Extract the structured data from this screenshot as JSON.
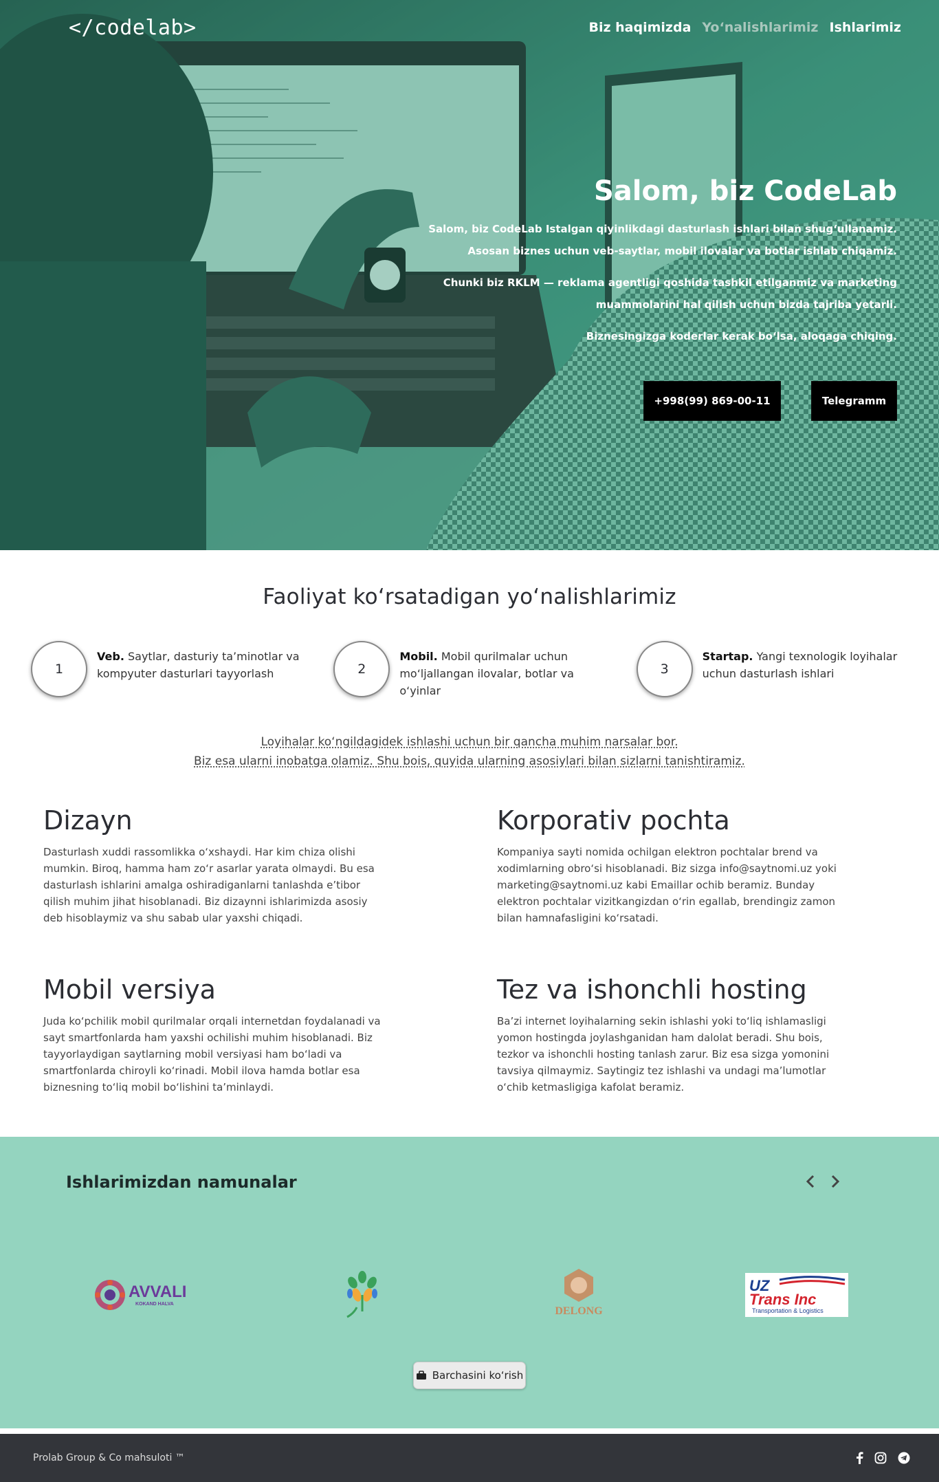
{
  "nav": {
    "logo": "</codelab>",
    "links": [
      {
        "label": "Biz haqimizda",
        "active": false
      },
      {
        "label": "Yo‘nalishlarimiz",
        "active": true
      },
      {
        "label": "Ishlarimiz",
        "active": false
      }
    ]
  },
  "hero": {
    "title": "Salom, biz CodeLab",
    "paragraphs": [
      "Salom, biz CodeLab Istalgan qiyinlikdagi dasturlash ishlari bilan shug‘ullanamiz. Asosan biznes uchun veb-saytlar, mobil ilovalar va botlar ishlab chiqamiz.",
      "Chunki biz RKLM — reklama agentligi qoshida tashkil etilganmiz va marketing muammolarini hal qilish uchun bizda tajriba yetarli.",
      "Biznesingizga koderlar kerak bo‘lsa, aloqaga chiqing."
    ],
    "phone_button": "+998(99) 869-00-11",
    "telegram_button": "Telegramm"
  },
  "services": {
    "title": "Faoliyat ko‘rsatadigan yo‘nalishlarimiz",
    "steps": [
      {
        "number": "1",
        "bold": "Veb.",
        "text": "Saytlar, dasturiy ta’minotlar va kompyuter dasturlari tayyorlash"
      },
      {
        "number": "2",
        "bold": "Mobil.",
        "text": "Mobil qurilmalar uchun mo‘ljallangan ilovalar, botlar va o‘yinlar"
      },
      {
        "number": "3",
        "bold": "Startap.",
        "text": "Yangi texnologik loyihalar uchun dasturlash ishlari"
      }
    ],
    "intro_line1": "Loyihalar ko‘ngildagidek ishlashi uchun bir qancha muhim narsalar bor.",
    "intro_line2": "Biz esa ularni inobatga olamiz. Shu bois, quyida ularning asosiylari bilan sizlarni tanishtiramiz.",
    "features": [
      {
        "title": "Dizayn",
        "text": "Dasturlash xuddi rassomlikka o‘xshaydi. Har kim chiza olishi mumkin. Biroq, hamma ham zo‘r asarlar yarata olmaydi. Bu esa dasturlash ishlarini amalga oshiradiganlarni tanlashda e’tibor qilish muhim jihat hisoblanadi. Biz dizaynni ishlarimizda asosiy deb hisoblaymiz va shu sabab ular yaxshi chiqadi."
      },
      {
        "title": "Korporativ pochta",
        "text": "Kompaniya sayti nomida ochilgan elektron pochtalar brend va xodimlarning obro‘si hisoblanadi. Biz sizga info@saytnomi.uz yoki marketing@saytnomi.uz kabi Emaillar ochib beramiz. Bunday elektron pochtalar vizitkangizdan o‘rin egallab, brendingiz zamon bilan hamnafasligini ko‘rsatadi."
      },
      {
        "title": "Mobil versiya",
        "text": "Juda ko‘pchilik mobil qurilmalar orqali internetdan foydalanadi va sayt smartfonlarda ham yaxshi ochilishi muhim hisoblanadi. Biz tayyorlaydigan saytlarning mobil versiyasi ham bo‘ladi va smartfonlarda chiroyli ko‘rinadi. Mobil ilova hamda botlar esa biznesning to‘liq mobil bo‘lishini ta’minlaydi."
      },
      {
        "title": "Tez va ishonchli hosting",
        "text": "Ba’zi internet loyihalarning sekin ishlashi yoki to‘liq ishlamasligi yomon hostingda joylashganidan ham dalolat beradi. Shu bois, tezkor va ishonchli hosting tanlash zarur. Biz esa sizga yomonini tavsiya qilmaymiz. Saytingiz tez ishlashi va undagi ma’lumotlar o‘chib ketmasligiga kafolat beramiz."
      }
    ]
  },
  "portfolio": {
    "title": "Ishlarimizdan namunalar",
    "view_all": "Barchasini ko‘rish",
    "logos": [
      {
        "name": "AVVALI",
        "sub": "KOKAND HALVA"
      },
      {
        "name": "hands-tree-logo"
      },
      {
        "name": "DELONG"
      },
      {
        "name": "UZ Trans Inc",
        "sub": "Transportation & Logistics"
      }
    ]
  },
  "footer": {
    "copyright": "Prolab Group & Co mahsuloti ™"
  },
  "colors": {
    "accent": "#94d4bf",
    "hero_tint": "#3a8f78",
    "footer": "#33353a"
  }
}
